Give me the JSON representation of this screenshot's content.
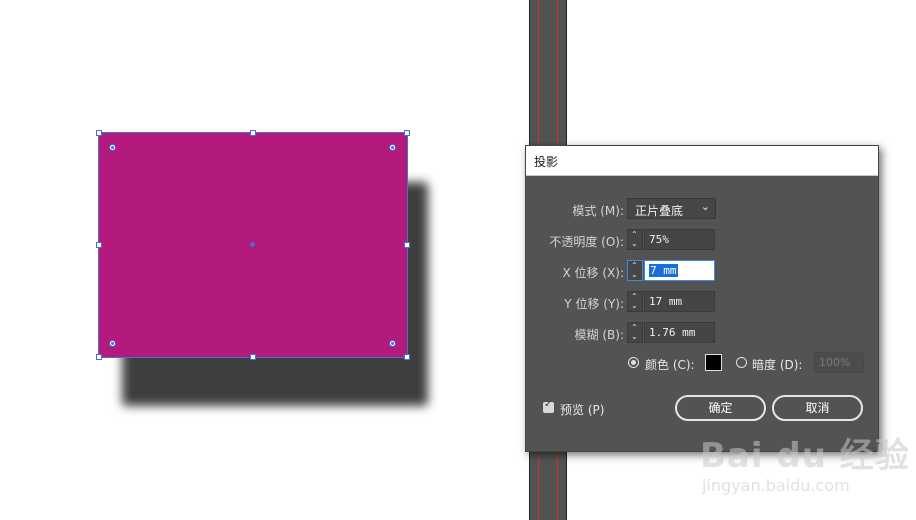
{
  "dialog": {
    "title": "投影",
    "mode": {
      "label": "模式 (M):",
      "value": "正片叠底"
    },
    "opacity": {
      "label": "不透明度 (O):",
      "value": "75%"
    },
    "x_offset": {
      "label": "X 位移 (X):",
      "value": "7 mm"
    },
    "y_offset": {
      "label": "Y 位移 (Y):",
      "value": "17 mm"
    },
    "blur": {
      "label": "模糊 (B):",
      "value": "1.76 mm"
    },
    "color_option": {
      "label": "颜色 (C):",
      "selected": true,
      "swatch": "#000000"
    },
    "darkness_option": {
      "label": "暗度 (D):",
      "selected": false,
      "value": "100%"
    },
    "preview": {
      "label": "预览 (P)",
      "checked": true
    },
    "ok_label": "确定",
    "cancel_label": "取消"
  },
  "artwork": {
    "fill_color": "#b4197c",
    "shadow_color": "#3e3e3e"
  },
  "watermark": {
    "logo_text": "Bai du 经验",
    "url_text": "jingyan.baidu.com"
  }
}
